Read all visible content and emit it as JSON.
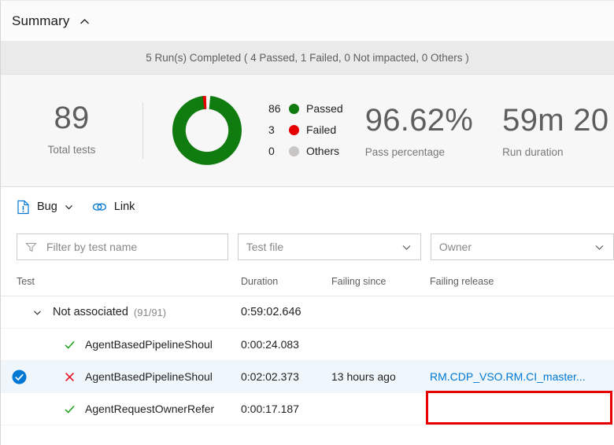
{
  "summary": {
    "title": "Summary",
    "collapse_icon": "chevron-up-icon",
    "run_banner": "5 Run(s) Completed ( 4 Passed, 1 Failed, 0 Not impacted, 0 Others )"
  },
  "metrics": {
    "total_tests": {
      "value": "89",
      "label": "Total tests"
    },
    "pass_percentage": {
      "value": "96.62%",
      "label": "Pass percentage"
    },
    "run_duration": {
      "value": "59m 20",
      "label": "Run duration"
    }
  },
  "chart_data": {
    "type": "pie",
    "title": "Test outcome distribution",
    "categories": [
      "Passed",
      "Failed",
      "Others"
    ],
    "values": [
      86,
      3,
      0
    ],
    "colors": [
      "#107c10",
      "#e60000",
      "#c8c6c4"
    ],
    "legend_position": "right",
    "donut": true,
    "total": 89
  },
  "legend": [
    {
      "count": "86",
      "label": "Passed",
      "color": "#107c10"
    },
    {
      "count": "3",
      "label": "Failed",
      "color": "#e60000"
    },
    {
      "count": "0",
      "label": "Others",
      "color": "#c8c6c4"
    }
  ],
  "commandbar": {
    "bug": {
      "label": "Bug",
      "icon": "bug-document-icon",
      "caret": "chevron-down-icon"
    },
    "link": {
      "label": "Link",
      "icon": "link-icon"
    }
  },
  "filters": {
    "test_name": {
      "placeholder": "Filter by test name",
      "value": "",
      "icon": "funnel-icon"
    },
    "test_file": {
      "value": "Test file",
      "caret": "chevron-down-icon"
    },
    "owner": {
      "value": "Owner",
      "caret": "chevron-down-icon"
    }
  },
  "table": {
    "columns": {
      "test": "Test",
      "duration": "Duration",
      "failing_since": "Failing since",
      "failing_release": "Failing release"
    },
    "rows": [
      {
        "type": "group",
        "caret": "chevron-down-icon",
        "name": "Not associated",
        "count": "(91/91)",
        "duration": "0:59:02.646",
        "failing_since": "",
        "failing_release": ""
      },
      {
        "type": "test",
        "status": "passed",
        "status_icon": "checkmark-icon",
        "name": "AgentBasedPipelineShoul",
        "duration": "0:00:24.083",
        "failing_since": "",
        "failing_release": "",
        "selected": false
      },
      {
        "type": "test",
        "status": "failed",
        "status_icon": "cross-icon",
        "name": "AgentBasedPipelineShoul",
        "duration": "0:02:02.373",
        "failing_since": "13 hours ago",
        "failing_release": "RM.CDP_VSO.RM.CI_master...",
        "selected": true,
        "check_icon": "checked-circle-icon"
      },
      {
        "type": "test",
        "status": "passed",
        "status_icon": "checkmark-icon",
        "name": "AgentRequestOwnerRefer",
        "duration": "0:00:17.187",
        "failing_since": "",
        "failing_release": "",
        "selected": false
      }
    ]
  },
  "annotation": {
    "shape": "rectangle",
    "color": "#e60000",
    "target": "failing-release-link"
  }
}
